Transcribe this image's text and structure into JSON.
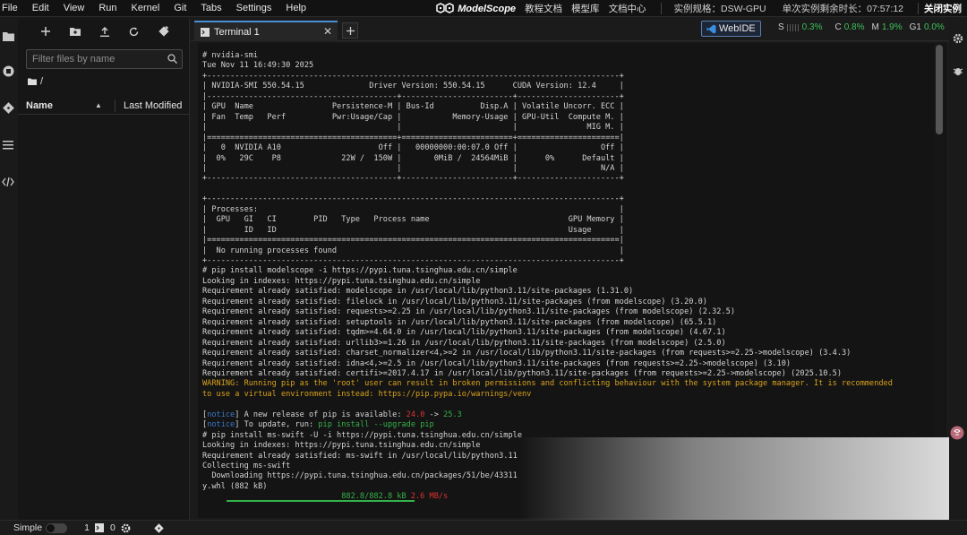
{
  "menubar": {
    "items": [
      "File",
      "Edit",
      "View",
      "Run",
      "Kernel",
      "Git",
      "Tabs",
      "Settings",
      "Help"
    ],
    "brand": "ModelScope",
    "links": [
      "教程文档",
      "模型库",
      "文档中心"
    ],
    "instance_spec": "实例规格：DSW-GPU",
    "time_left": "单次实例剩余时长：07:57:12",
    "close_instance": "关闭实例"
  },
  "filebrowser": {
    "filter_placeholder": "Filter files by name",
    "path": "/",
    "col_name": "Name",
    "col_modified": "Last Modified"
  },
  "tabs": {
    "active_tab": "Terminal 1",
    "webide": "WebIDE",
    "stats": [
      {
        "label": "S",
        "value": "0.3%"
      },
      {
        "label": "C",
        "value": "0.8%"
      },
      {
        "label": "M",
        "value": "1.9%"
      },
      {
        "label": "G1",
        "value": "0.0%"
      }
    ]
  },
  "terminal": {
    "lines": [
      {
        "t": "# nvidia-smi"
      },
      {
        "t": "Tue Nov 11 16:49:30 2025"
      },
      {
        "t": "+-----------------------------------------------------------------------------------------+"
      },
      {
        "t": "| NVIDIA-SMI 550.54.15              Driver Version: 550.54.15      CUDA Version: 12.4     |"
      },
      {
        "t": "|-----------------------------------------+------------------------+----------------------+"
      },
      {
        "t": "| GPU  Name                 Persistence-M | Bus-Id          Disp.A | Volatile Uncorr. ECC |"
      },
      {
        "t": "| Fan  Temp   Perf          Pwr:Usage/Cap |           Memory-Usage | GPU-Util  Compute M. |"
      },
      {
        "t": "|                                         |                        |               MIG M. |"
      },
      {
        "t": "|=========================================+========================+======================|"
      },
      {
        "t": "|   0  NVIDIA A10                     Off |   00000000:00:07.0 Off |                  Off |"
      },
      {
        "t": "|  0%   29C    P8             22W /  150W |       0MiB /  24564MiB |      0%      Default |"
      },
      {
        "t": "|                                         |                        |                  N/A |"
      },
      {
        "t": "+-----------------------------------------+------------------------+----------------------+"
      },
      {
        "t": ""
      },
      {
        "t": "+-----------------------------------------------------------------------------------------+"
      },
      {
        "t": "| Processes:                                                                              |"
      },
      {
        "t": "|  GPU   GI   CI        PID   Type   Process name                              GPU Memory |"
      },
      {
        "t": "|        ID   ID                                                               Usage      |"
      },
      {
        "t": "|=========================================================================================|"
      },
      {
        "t": "|  No running processes found                                                             |"
      },
      {
        "t": "+-----------------------------------------------------------------------------------------+"
      },
      {
        "t": "# pip install modelscope -i https://pypi.tuna.tsinghua.edu.cn/simple"
      },
      {
        "t": "Looking in indexes: https://pypi.tuna.tsinghua.edu.cn/simple"
      },
      {
        "t": "Requirement already satisfied: modelscope in /usr/local/lib/python3.11/site-packages (1.31.0)"
      },
      {
        "t": "Requirement already satisfied: filelock in /usr/local/lib/python3.11/site-packages (from modelscope) (3.20.0)"
      },
      {
        "t": "Requirement already satisfied: requests>=2.25 in /usr/local/lib/python3.11/site-packages (from modelscope) (2.32.5)"
      },
      {
        "t": "Requirement already satisfied: setuptools in /usr/local/lib/python3.11/site-packages (from modelscope) (65.5.1)"
      },
      {
        "t": "Requirement already satisfied: tqdm>=4.64.0 in /usr/local/lib/python3.11/site-packages (from modelscope) (4.67.1)"
      },
      {
        "t": "Requirement already satisfied: urllib3>=1.26 in /usr/local/lib/python3.11/site-packages (from modelscope) (2.5.0)"
      },
      {
        "t": "Requirement already satisfied: charset_normalizer<4,>=2 in /usr/local/lib/python3.11/site-packages (from requests>=2.25->modelscope) (3.4.3)"
      },
      {
        "t": "Requirement already satisfied: idna<4,>=2.5 in /usr/local/lib/python3.11/site-packages (from requests>=2.25->modelscope) (3.10)"
      },
      {
        "t": "Requirement already satisfied: certifi>=2017.4.17 in /usr/local/lib/python3.11/site-packages (from requests>=2.25->modelscope) (2025.10.5)"
      },
      {
        "t": "WARNING: Running pip as the 'root' user can result in broken permissions and conflicting behaviour with the system package manager. It is recommended",
        "c": "warn"
      },
      {
        "t": "to use a virtual environment instead: https://pip.pypa.io/warnings/venv",
        "c": "warn"
      },
      {
        "t": ""
      },
      {
        "segs": [
          {
            "t": "[",
            "c": ""
          },
          {
            "t": "notice",
            "c": "notice"
          },
          {
            "t": "] A new release of pip is available: ",
            "c": ""
          },
          {
            "t": "24.0",
            "c": "red"
          },
          {
            "t": " -> ",
            "c": ""
          },
          {
            "t": "25.3",
            "c": "green"
          }
        ]
      },
      {
        "segs": [
          {
            "t": "[",
            "c": ""
          },
          {
            "t": "notice",
            "c": "notice"
          },
          {
            "t": "] To update, run: ",
            "c": ""
          },
          {
            "t": "pip install --upgrade pip",
            "c": "green"
          }
        ]
      },
      {
        "t": "# pip install ms-swift -U -i https://pypi.tuna.tsinghua.edu.cn/simple"
      },
      {
        "t": "Looking in indexes: https://pypi.tuna.tsinghua.edu.cn/simple"
      },
      {
        "t": "Requirement already satisfied: ms-swift in /usr/local/lib/python3.11"
      },
      {
        "t": "Collecting ms-swift"
      },
      {
        "t": "  Downloading https://pypi.tuna.tsinghua.edu.cn/packages/51/be/43311"
      },
      {
        "t": "y.whl (882 kB)"
      },
      {
        "segs": [
          {
            "t": "                              ",
            "c": ""
          },
          {
            "t": "882.8/882.8 kB",
            "c": "green"
          },
          {
            "t": " 2.6 MB/s",
            "c": "red"
          }
        ]
      }
    ],
    "download_progress": 1.0
  },
  "statusbar": {
    "mode": "Simple",
    "count1": "1",
    "count2": "0"
  }
}
